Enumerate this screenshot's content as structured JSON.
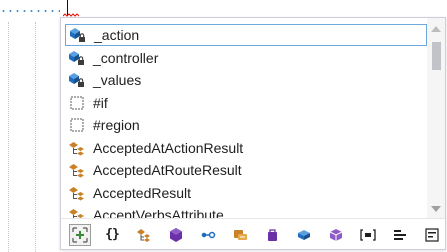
{
  "completion": {
    "items": [
      {
        "label": "_action",
        "icon": "private-field-icon",
        "selected": true
      },
      {
        "label": "_controller",
        "icon": "private-field-icon",
        "selected": false
      },
      {
        "label": "_values",
        "icon": "private-field-icon",
        "selected": false
      },
      {
        "label": "#if",
        "icon": "snippet-icon",
        "selected": false
      },
      {
        "label": "#region",
        "icon": "snippet-icon",
        "selected": false
      },
      {
        "label": "AcceptedAtActionResult",
        "icon": "class-icon",
        "selected": false
      },
      {
        "label": "AcceptedAtRouteResult",
        "icon": "class-icon",
        "selected": false
      },
      {
        "label": "AcceptedResult",
        "icon": "class-icon",
        "selected": false
      },
      {
        "label": "AcceptVerbsAttribute",
        "icon": "class-icon",
        "selected": false
      }
    ],
    "toolbar": [
      {
        "name": "expander-filter-button",
        "icon": "add-items-icon"
      },
      {
        "name": "namespace-filter-button",
        "icon": "namespace-braces-icon"
      },
      {
        "name": "class-filter-button",
        "icon": "class-icon"
      },
      {
        "name": "method-filter-button",
        "icon": "method-icon"
      },
      {
        "name": "interface-filter-button",
        "icon": "interface-icon"
      },
      {
        "name": "delegate-filter-button",
        "icon": "delegate-icon"
      },
      {
        "name": "struct-filter-button",
        "icon": "struct-icon"
      },
      {
        "name": "field-filter-button",
        "icon": "field-icon"
      },
      {
        "name": "enum-filter-button",
        "icon": "enum-icon"
      },
      {
        "name": "snippet-filter-button",
        "icon": "snippet-brackets-icon"
      },
      {
        "name": "keyword-filter-button",
        "icon": "keyword-icon"
      },
      {
        "name": "local-filter-button",
        "icon": "local-icon"
      }
    ]
  },
  "colors": {
    "selection_border": "#6fa8dc",
    "field_blue": "#1e6ebf",
    "class_orange": "#c9822a",
    "struct_purple": "#6b2fa8",
    "toolbar_green": "#388a34"
  }
}
